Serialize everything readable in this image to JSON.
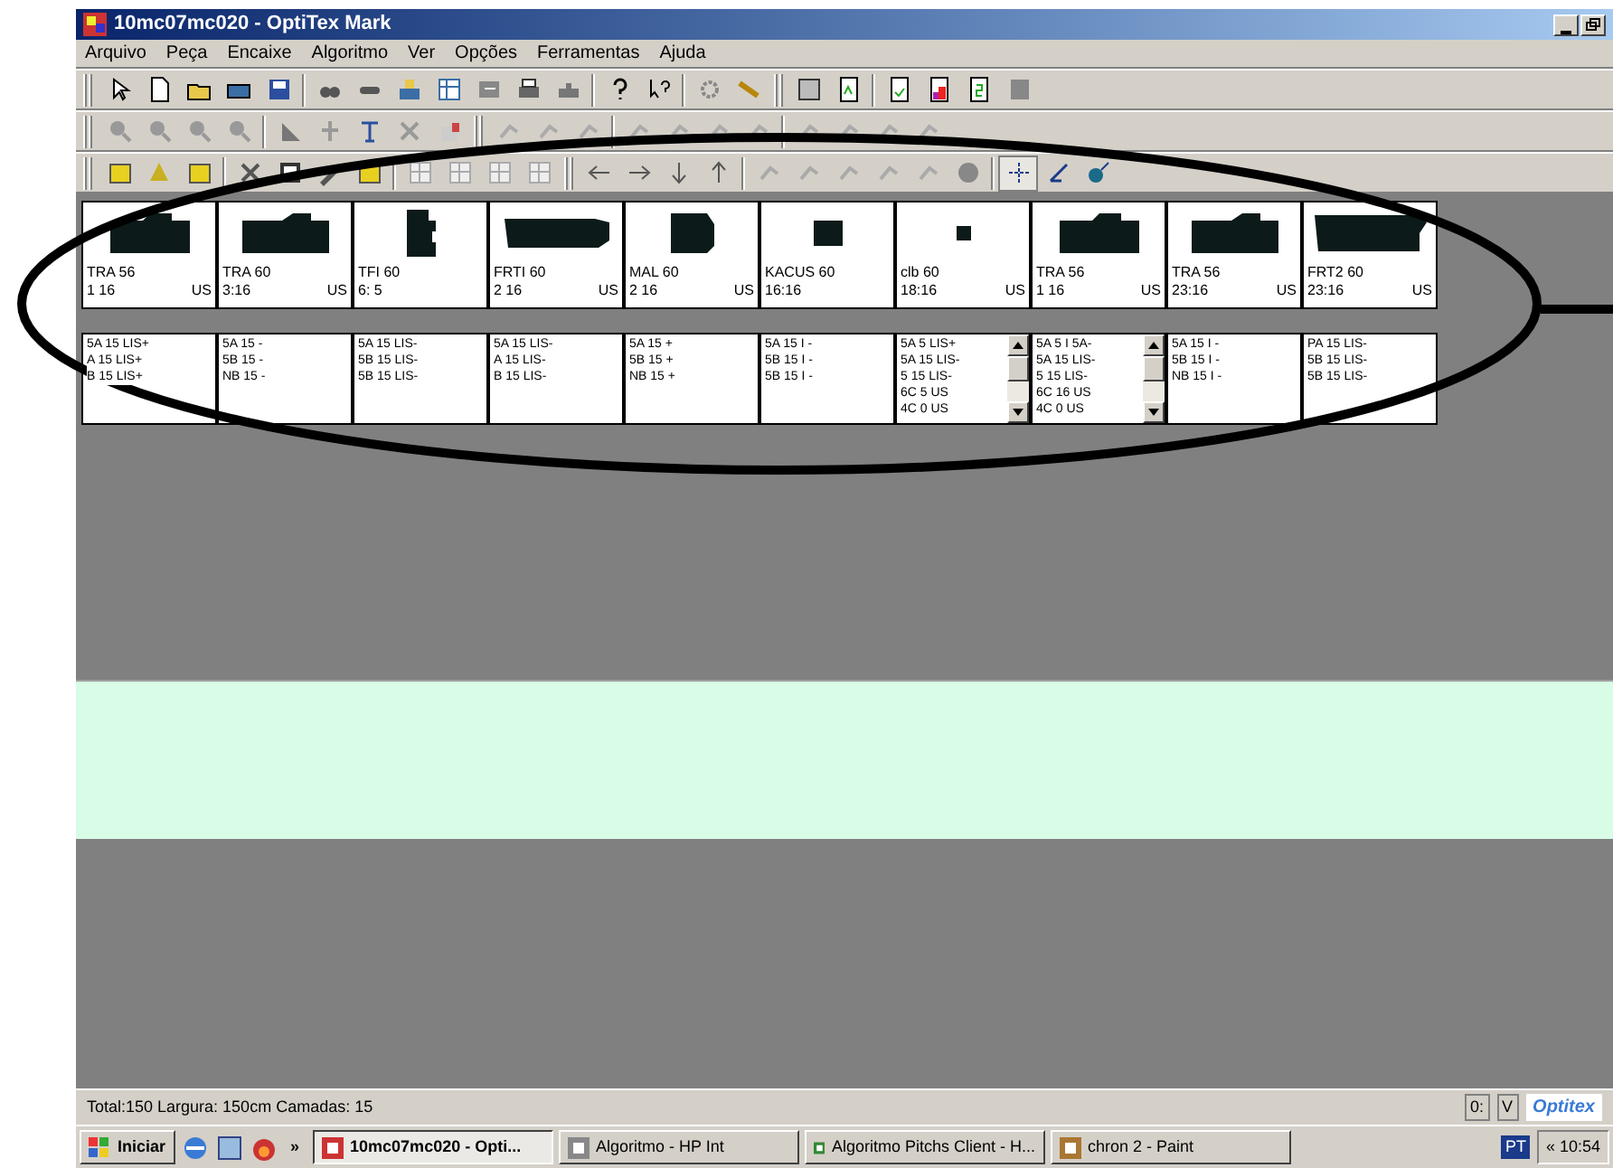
{
  "window": {
    "title": "10mc07mc020 - OptiTex Mark"
  },
  "menu": [
    "Arquivo",
    "Peça",
    "Encaixe",
    "Algoritmo",
    "Ver",
    "Opções",
    "Ferramentas",
    "Ajuda"
  ],
  "pieces": [
    {
      "name": "TRA 56",
      "count": "1 16",
      "unit": "US",
      "lines": [
        "5A 15 LIS+",
        "A 15 LIS+",
        "B 15 LIS+"
      ],
      "scrollbar": false
    },
    {
      "name": "TRA 60",
      "count": "3:16",
      "unit": "US",
      "lines": [
        "5A 15 -",
        "5B 15 -",
        "NB 15 -"
      ],
      "scrollbar": false
    },
    {
      "name": "TFI 60",
      "count": "6: 5",
      "lines": [
        "5A 15 LIS-",
        "5B 15 LIS-",
        "5B 15 LIS-"
      ],
      "scrollbar": false
    },
    {
      "name": "FRTI 60",
      "count": "2 16",
      "unit": "US",
      "lines": [
        "5A 15 LIS-",
        "A 15 LIS-",
        "B 15 LIS-"
      ],
      "scrollbar": false
    },
    {
      "name": "MAL 60",
      "count": "2 16",
      "unit": "US",
      "lines": [
        "5A 15 +",
        "5B 15 +",
        "NB 15 +"
      ],
      "scrollbar": false
    },
    {
      "name": "KACUS 60",
      "count": "16:16",
      "lines": [
        "5A 15 I -",
        "5B 15 I -",
        "5B 15 I -"
      ],
      "scrollbar": false
    },
    {
      "name": "clb 60",
      "count": "18:16",
      "unit": "US",
      "lines": [
        "5A 5 LIS+",
        "5A 15 LIS-",
        "5 15 LIS-",
        "6C 5 US",
        "4C 0 US"
      ],
      "scrollbar": true
    },
    {
      "name": "TRA 56",
      "count": "1 16",
      "unit": "US",
      "lines": [
        "5A 5 I 5A-",
        "5A 15 LIS-",
        "5 15 LIS-",
        "6C 16 US",
        "4C 0 US"
      ],
      "scrollbar": true
    },
    {
      "name": "TRA 56",
      "count": "23:16",
      "unit": "US",
      "lines": [
        "5A 15 I -",
        "5B 15 I -",
        "NB 15 I -"
      ],
      "scrollbar": false
    },
    {
      "name": "FRT2 60",
      "count": "23:16",
      "unit": "US",
      "lines": [
        "PA 15 LIS-",
        "5B 15 LIS-",
        "5B 15 LIS-"
      ],
      "scrollbar": false
    }
  ],
  "status_bar": {
    "text": "Total:150 Largura: 150cm Camadas: 15",
    "indicator_1": "0:",
    "indicator_2": "V",
    "logo": "Optitex"
  },
  "taskbar": {
    "start": "Iniciar",
    "more": "»",
    "tasks": [
      {
        "label": "10mc07mc020 - Opti...",
        "selected": true
      },
      {
        "label": "Algoritmo - HP Int",
        "selected": false
      },
      {
        "label": "Algoritmo Pitchs Client - H...",
        "selected": false
      },
      {
        "label": "chron 2 - Paint",
        "selected": false
      }
    ],
    "language": "PT",
    "clock": "« 10:54"
  }
}
